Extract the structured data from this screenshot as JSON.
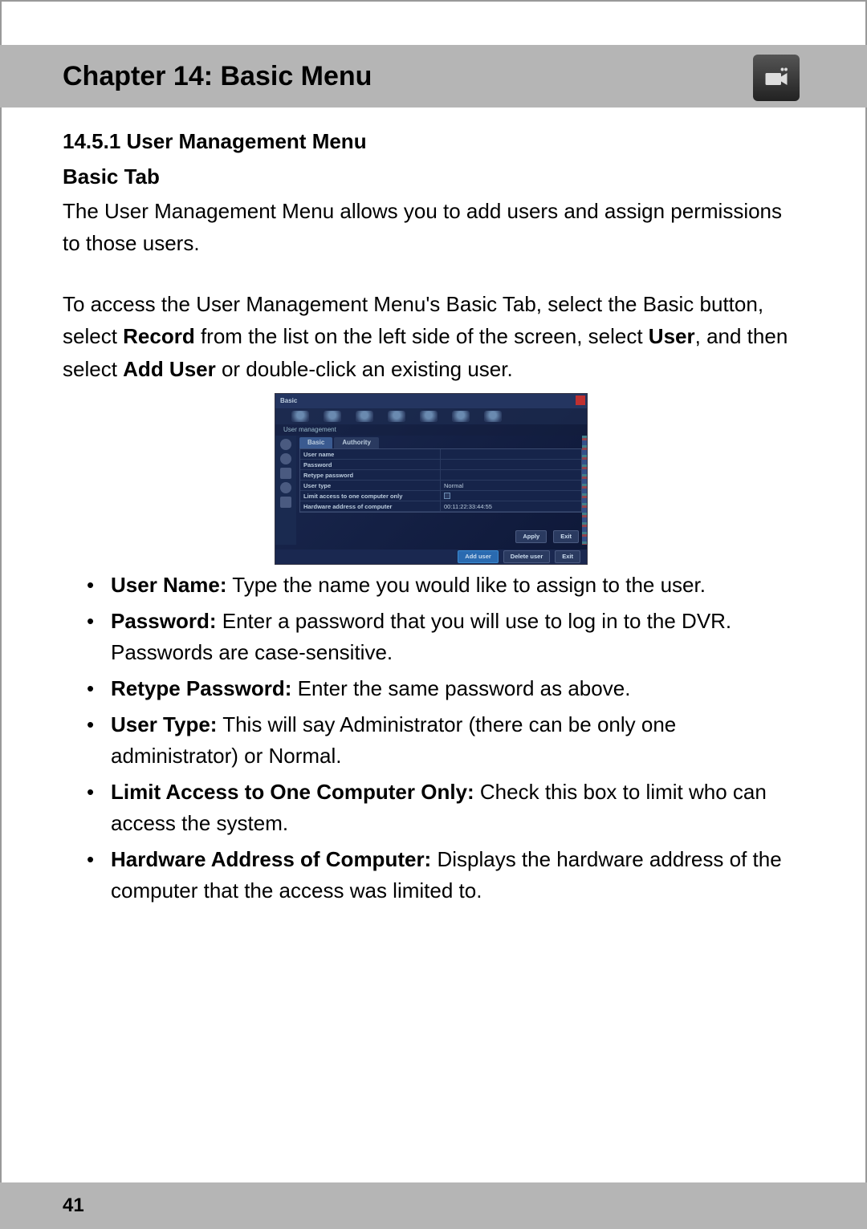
{
  "header": {
    "chapter_title": "Chapter 14: Basic Menu",
    "icon": "camera-icon"
  },
  "section": {
    "number_title": "14.5.1 User Management Menu",
    "subheading": "Basic Tab",
    "intro": "The User Management Menu allows you to add users and assign permissions to those users.",
    "access_pre": "To access the User Management Menu's Basic Tab, select the Basic button, select ",
    "access_bold1": "Record",
    "access_mid1": " from the list on the left side of the screen, select ",
    "access_bold2": "User",
    "access_mid2": ", and then select ",
    "access_bold3": "Add User",
    "access_end": " or double-click an existing user."
  },
  "screenshot": {
    "topbar_title": "Basic",
    "breadcrumb": "User management",
    "tabs": {
      "active": "Basic",
      "other": "Authority"
    },
    "rows": [
      {
        "label": "User name",
        "value": ""
      },
      {
        "label": "Password",
        "value": ""
      },
      {
        "label": "Retype password",
        "value": ""
      },
      {
        "label": "User type",
        "value": "Normal"
      },
      {
        "label": "Limit access to one computer only",
        "value": "checkbox"
      },
      {
        "label": "Hardware address of computer",
        "value": "00:11:22:33:44:55"
      }
    ],
    "buttons_inner": {
      "apply": "Apply",
      "exit": "Exit"
    },
    "buttons_footer": {
      "add": "Add user",
      "delete": "Delete user",
      "exit": "Exit"
    }
  },
  "bullets": [
    {
      "label": "User Name:",
      "text": " Type the name you would like to assign to the user."
    },
    {
      "label": "Password:",
      "text": " Enter a password that you will use to log in to the DVR. Passwords are case-sensitive."
    },
    {
      "label": "Retype Password:",
      "text": " Enter the same password as above."
    },
    {
      "label": "User Type:",
      "text": " This will say Administrator (there can be only one administrator) or Normal."
    },
    {
      "label": "Limit Access to One Computer Only:",
      "text": " Check this box to limit who can access the system."
    },
    {
      "label": "Hardware Address of Computer:",
      "text": " Displays the hardware address of the computer that the access was limited to."
    }
  ],
  "footer": {
    "page_number": "41"
  }
}
